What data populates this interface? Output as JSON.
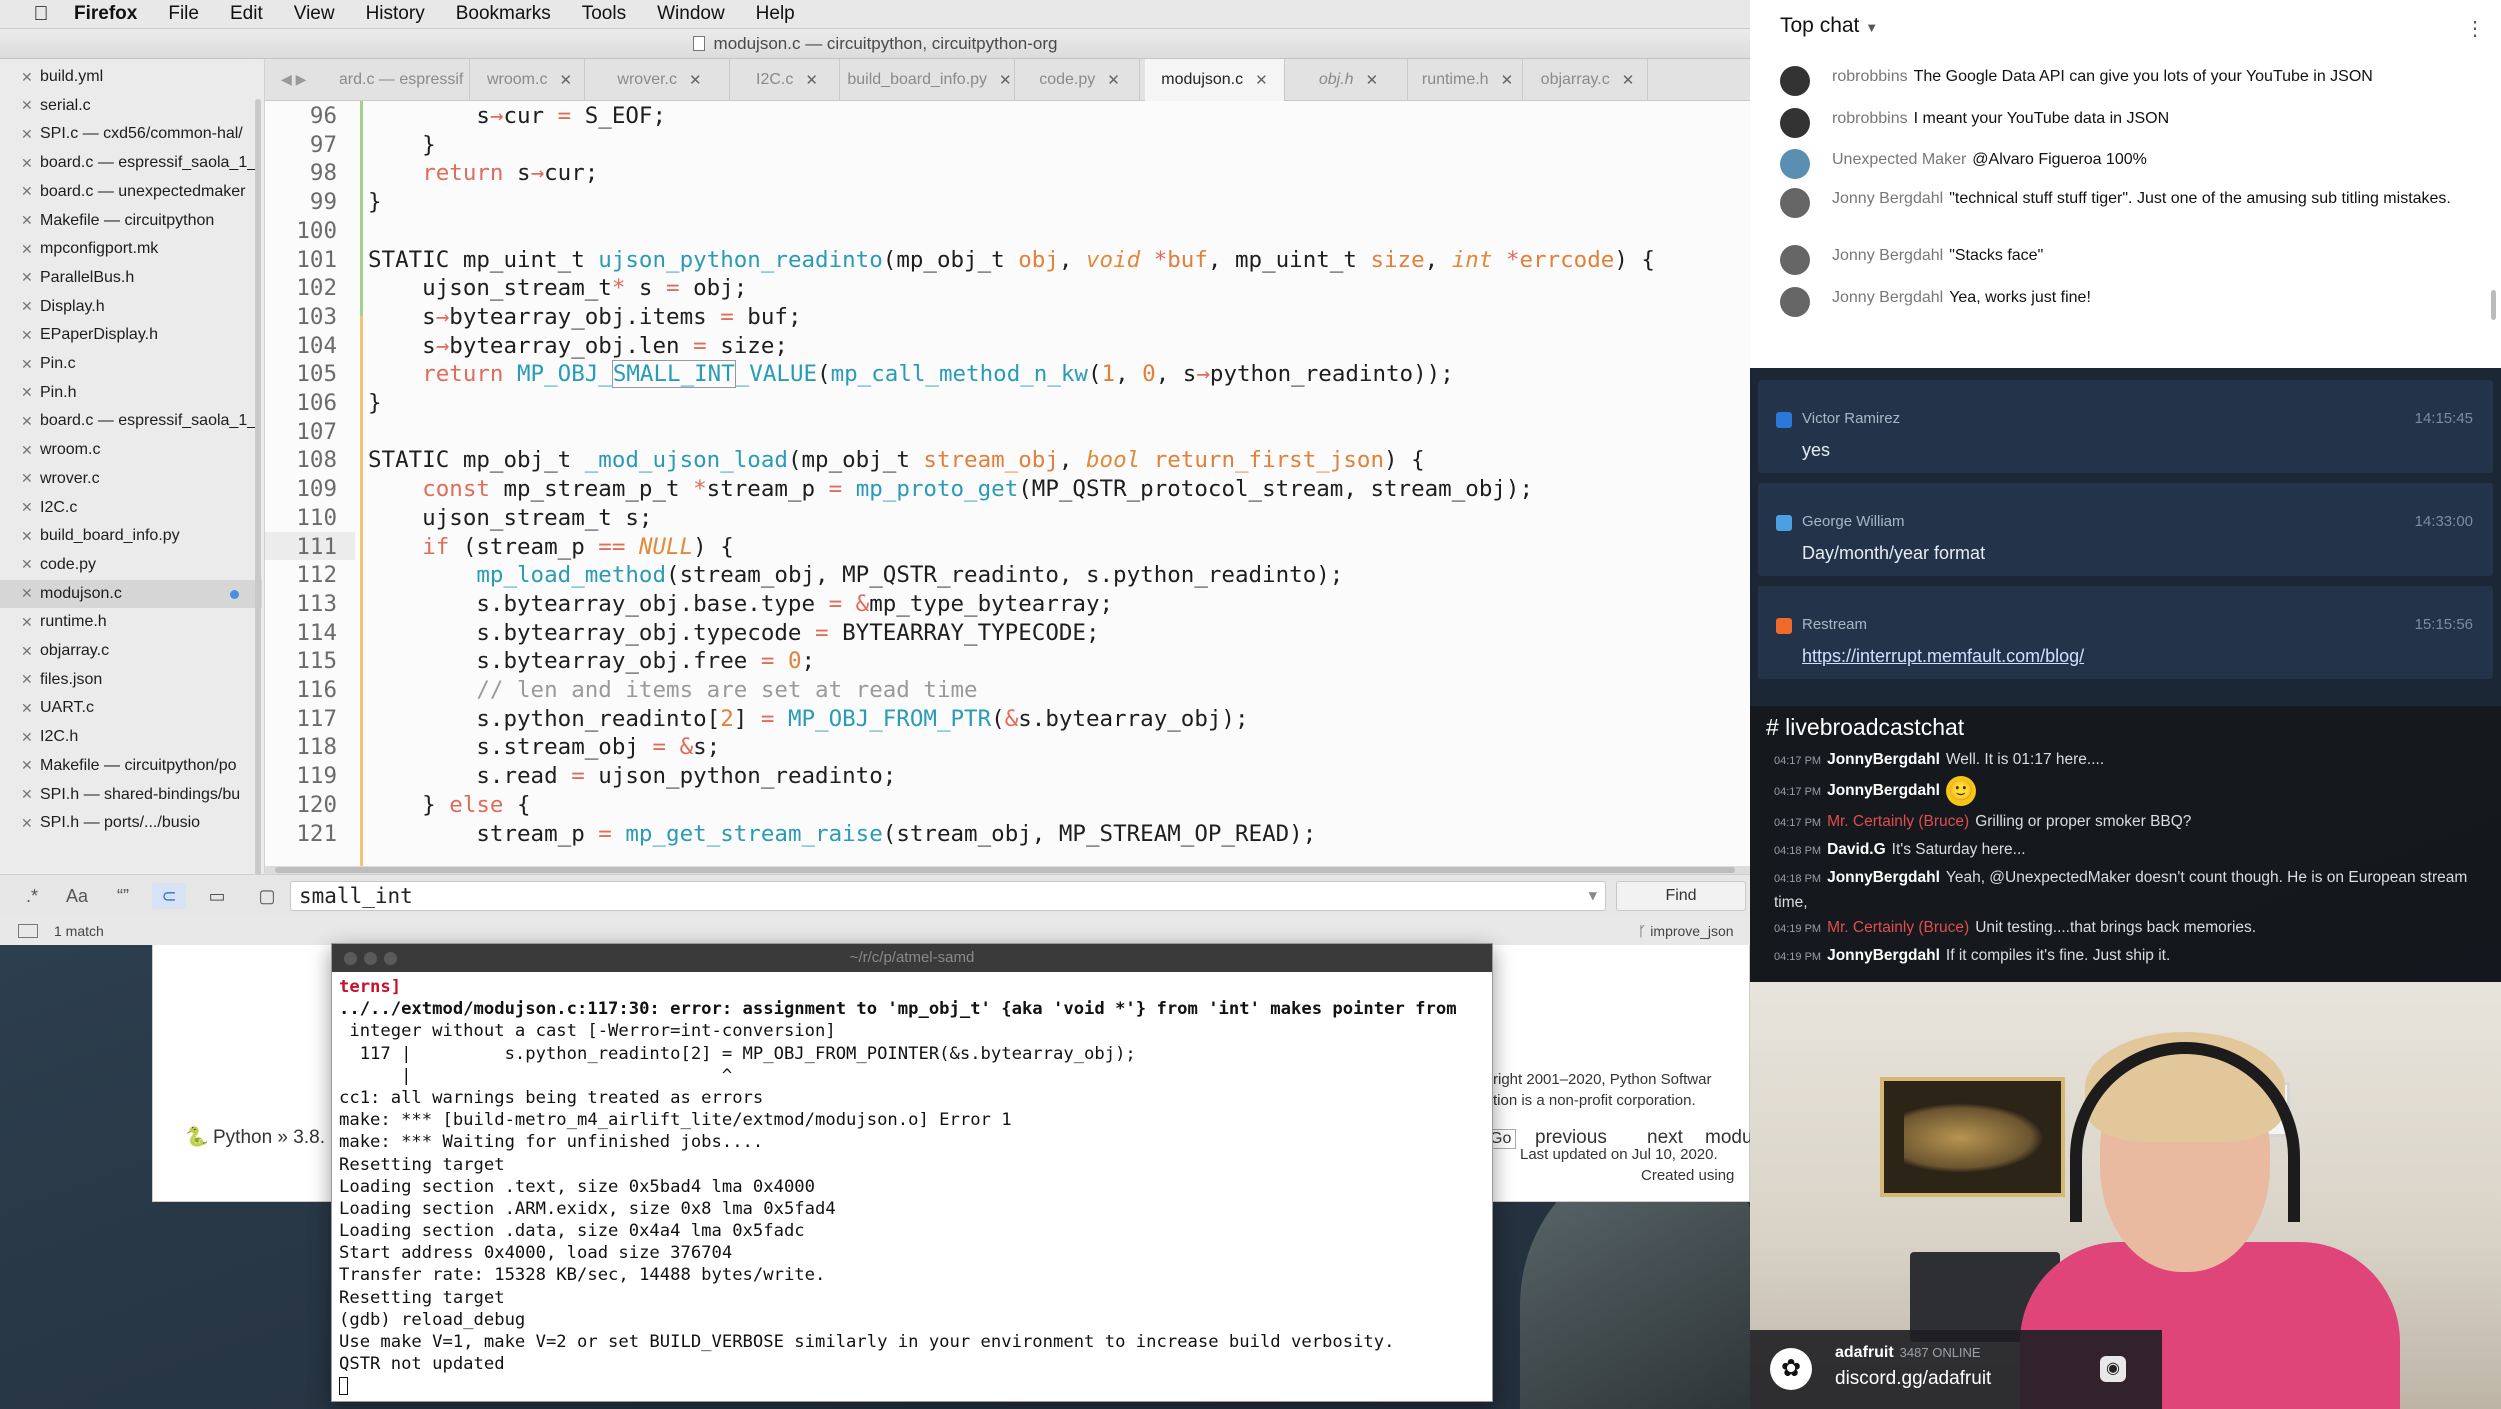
{
  "menubar": {
    "app": "Firefox",
    "items": [
      "File",
      "Edit",
      "View",
      "History",
      "Bookmarks",
      "Tools",
      "Window",
      "Help"
    ]
  },
  "editor": {
    "title": "modujson.c — circuitpython, circuitpython-org",
    "sidebar_files": [
      {
        "name": "build.yml"
      },
      {
        "name": "serial.c"
      },
      {
        "name": "SPI.c — cxd56/common-hal/"
      },
      {
        "name": "board.c — espressif_saola_1_"
      },
      {
        "name": "board.c — unexpectedmaker"
      },
      {
        "name": "Makefile — circuitpython"
      },
      {
        "name": "mpconfigport.mk"
      },
      {
        "name": "ParallelBus.h"
      },
      {
        "name": "Display.h"
      },
      {
        "name": "EPaperDisplay.h"
      },
      {
        "name": "Pin.c"
      },
      {
        "name": "Pin.h"
      },
      {
        "name": "board.c — espressif_saola_1_"
      },
      {
        "name": "wroom.c"
      },
      {
        "name": "wrover.c"
      },
      {
        "name": "I2C.c"
      },
      {
        "name": "build_board_info.py"
      },
      {
        "name": "code.py"
      },
      {
        "name": "modujson.c",
        "active": true
      },
      {
        "name": "runtime.h"
      },
      {
        "name": "objarray.c"
      },
      {
        "name": "files.json"
      },
      {
        "name": "UART.c"
      },
      {
        "name": "I2C.h"
      },
      {
        "name": "Makefile — circuitpython/po"
      },
      {
        "name": "SPI.h — shared-bindings/bu"
      },
      {
        "name": "SPI.h — ports/.../busio"
      }
    ],
    "tabs": [
      {
        "label": "board.c — espressif"
      },
      {
        "label": "wroom.c"
      },
      {
        "label": "wrover.c"
      },
      {
        "label": "I2C.c"
      },
      {
        "label": "build_board_info.py"
      },
      {
        "label": "code.py"
      },
      {
        "label": "modujson.c",
        "active": true
      },
      {
        "label": "obj.h"
      },
      {
        "label": "runtime.h"
      },
      {
        "label": "objarray.c"
      }
    ],
    "line_numbers": [
      "96",
      "97",
      "98",
      "99",
      "100",
      "101",
      "102",
      "103",
      "104",
      "105",
      "106",
      "107",
      "108",
      "109",
      "110",
      "111",
      "112",
      "113",
      "114",
      "115",
      "116",
      "117",
      "118",
      "119",
      "120",
      "121"
    ],
    "find": {
      "query": "small_int",
      "button": "Find",
      "match_count": "1 match",
      "branch": "improve_json"
    }
  },
  "terminal": {
    "title": "~/r/c/p/atmel-samd",
    "lines": [
      "terns]",
      "../../extmod/modujson.c:117:30: error: assignment to 'mp_obj_t' {aka 'void *'} from 'int' makes pointer from",
      " integer without a cast [-Werror=int-conversion]",
      "  117 |         s.python_readinto[2] = MP_OBJ_FROM_POINTER(&s.bytearray_obj);",
      "      |                              ^",
      "cc1: all warnings being treated as errors",
      "make: *** [build-metro_m4_airlift_lite/extmod/modujson.o] Error 1",
      "make: *** Waiting for unfinished jobs....",
      "Resetting target",
      "Loading section .text, size 0x5bad4 lma 0x4000",
      "Loading section .ARM.exidx, size 0x8 lma 0x5fad4",
      "Loading section .data, size 0x4a4 lma 0x5fadc",
      "Start address 0x4000, load size 376704",
      "Transfer rate: 15328 KB/sec, 14488 bytes/write.",
      "Resetting target",
      "(gdb) reload_debug",
      "Use make V=1, make V=2 or set BUILD_VERBOSE similarly in your environment to increase build verbosity.",
      "QSTR not updated"
    ]
  },
  "browser": {
    "python_crumb": "Python » 3.8.",
    "nav_go": "Go",
    "nav_previous": "previous",
    "nav_next": "next",
    "nav_modu": "modu",
    "copyright_1": "right 2001–2020, Python Softwar",
    "copyright_2": "tion is a non-profit corporation.",
    "updated": "Last updated on Jul 10, 2020.",
    "created": "Created using"
  },
  "youtube_chat": {
    "header": "Top chat",
    "messages": [
      {
        "user": "robrobbins",
        "text": "The Google Data API can give you lots of your YouTube in JSON"
      },
      {
        "user": "robrobbins",
        "text": "I meant your YouTube data in JSON"
      },
      {
        "user": "Unexpected Maker",
        "text": "@Alvaro Figueroa 100%"
      },
      {
        "user": "Jonny Bergdahl",
        "text": "\"technical stuff stuff tiger\". Just one of the amusing sub titling mistakes."
      },
      {
        "user": "Jonny Bergdahl",
        "text": "\"Stacks face\""
      },
      {
        "user": "Jonny Bergdahl",
        "text": "Yea, works just fine!"
      }
    ]
  },
  "stream_cards": [
    {
      "user": "Victor Ramirez",
      "time": "14:15:45",
      "text": "yes",
      "icon_color": "#2a79d8"
    },
    {
      "user": "George William",
      "time": "14:33:00",
      "text": "Day/month/year format",
      "icon_color": "#4aa0e0"
    },
    {
      "user": "Restream",
      "time": "15:15:56",
      "text": "https://interrupt.memfault.com/blog/",
      "icon_color": "#f06a2b"
    }
  ],
  "discord": {
    "channel": "# livebroadcastchat",
    "messages": [
      {
        "time": "04:17 PM",
        "user": "JonnyBergdahl",
        "text": "Well. It is 01:17 here....",
        "red": false
      },
      {
        "time": "04:17 PM",
        "user": "JonnyBergdahl",
        "text": "",
        "red": false,
        "emoji": "🙂"
      },
      {
        "time": "04:17 PM",
        "user": "Mr. Certainly (Bruce)",
        "text": "Grilling or proper smoker BBQ?",
        "red": true
      },
      {
        "time": "04:18 PM",
        "user": "David.G",
        "text": "It's Saturday here...",
        "red": false
      },
      {
        "time": "04:18 PM",
        "user": "JonnyBergdahl",
        "text": "Yeah, @UnexpectedMaker doesn't count though. He is on European stream time,",
        "red": false
      },
      {
        "time": "04:19 PM",
        "user": "Mr. Certainly (Bruce)",
        "text": "Unit testing....that brings back memories.",
        "red": true
      },
      {
        "time": "04:19 PM",
        "user": "JonnyBergdahl",
        "text": "If it compiles it's fine. Just ship it.",
        "red": false
      }
    ]
  },
  "discord_badge": {
    "server": "adafruit",
    "online": "3487 ONLINE",
    "invite": "discord.gg/adafruit"
  }
}
